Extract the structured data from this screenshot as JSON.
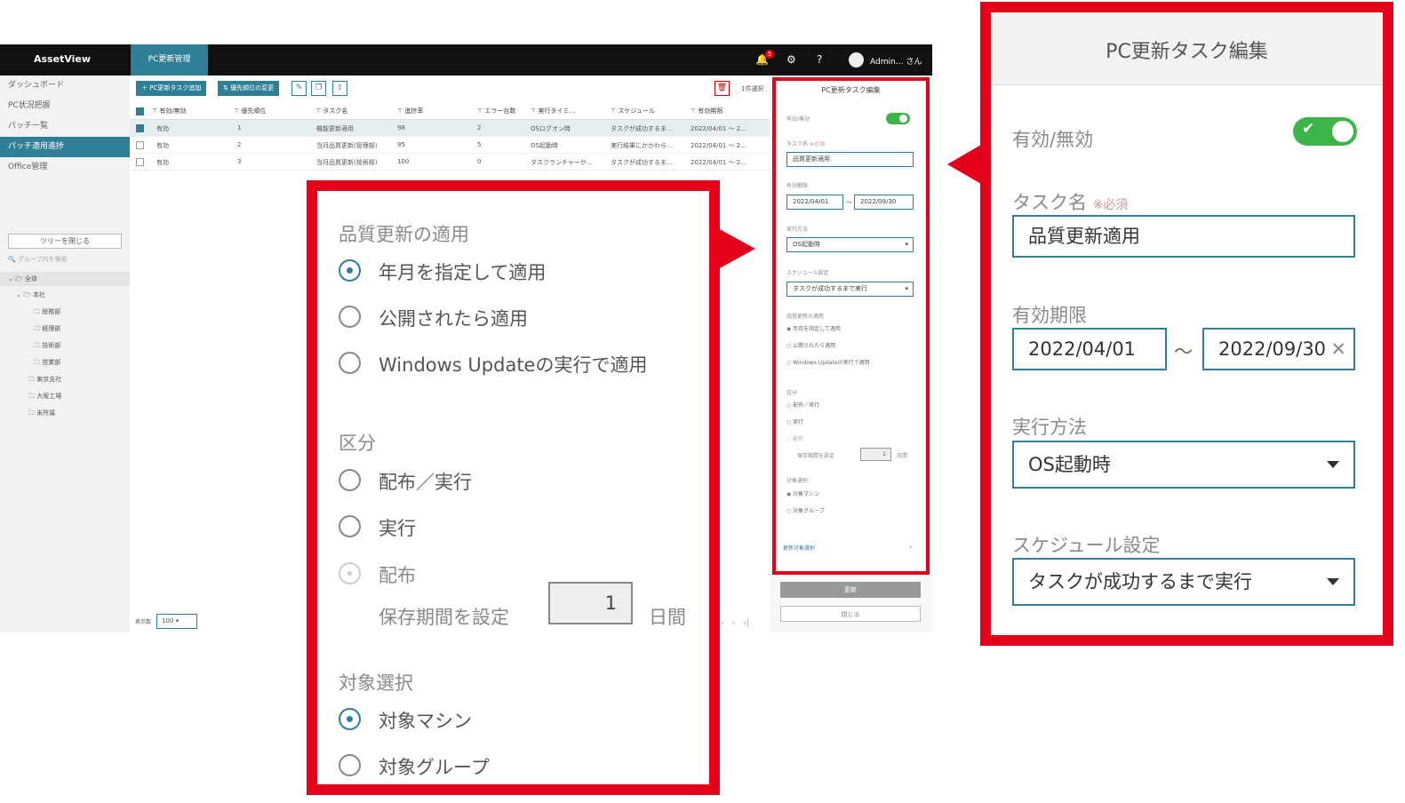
{
  "header": {
    "logo": "AssetView",
    "active_tab": "PC更新管理",
    "notification_count": "5",
    "user": "Admin… さん"
  },
  "sidebar": {
    "items": [
      {
        "label": "ダッシュボード"
      },
      {
        "label": "PC状況把握"
      },
      {
        "label": "パッチ一覧"
      },
      {
        "label": "パッチ適用進捗"
      },
      {
        "label": "Office管理"
      }
    ],
    "tree_button": "ツリーを閉じる",
    "group_search_placeholder": "グループ内を検索",
    "tree": {
      "root": "全体",
      "hq": "本社",
      "depts": [
        "総務部",
        "経理部",
        "技術部",
        "営業部"
      ],
      "branches": [
        "東京支社",
        "大阪工場",
        "未所属"
      ]
    }
  },
  "toolbar": {
    "add_task": "＋ PC更新タスク追加",
    "change_priority": "⇅ 優先順位の変更",
    "selected_count": "1件選択"
  },
  "table": {
    "headers": [
      "有効/無効",
      "優先順位",
      "タスク名",
      "進捗率",
      "エラー台数",
      "実行タイミ…",
      "スケジュール",
      "有効期限"
    ],
    "rows": [
      {
        "enabled": "有効",
        "priority": "1",
        "name": "機能更新適用",
        "progress": "98",
        "errors": "2",
        "timing": "OSログオン時",
        "schedule": "タスクが成功するま…",
        "expiry": "2022/04/01 ～ 2…"
      },
      {
        "enabled": "有効",
        "priority": "2",
        "name": "当月品質更新(管理部)",
        "progress": "95",
        "errors": "5",
        "timing": "OS起動時",
        "schedule": "実行結果にかかわら…",
        "expiry": "2022/04/01 ～ 2…"
      },
      {
        "enabled": "有効",
        "priority": "3",
        "name": "当月品質更新(技術部)",
        "progress": "100",
        "errors": "0",
        "timing": "タスクランチャーか…",
        "schedule": "タスクが成功するま…",
        "expiry": "2022/04/01 ～ 2…"
      }
    ],
    "page_size_label": "表示数",
    "page_size": "100"
  },
  "panel": {
    "title": "PC更新タスク編集",
    "enabled_label": "有効/無効",
    "task_name_label": "タスク名",
    "required_mark": "※必須",
    "task_name_value": "品質更新適用",
    "expiry_label": "有効期限",
    "expiry_from": "2022/04/01",
    "expiry_to": "2022/09/30",
    "tilde": "～",
    "method_label": "実行方法",
    "method_value": "OS起動時",
    "schedule_label": "スケジュール設定",
    "schedule_value": "タスクが成功するまで実行",
    "quality_label": "品質更新の適用",
    "quality_options": [
      "年月を指定して適用",
      "公開されたら適用",
      "Windows Updateの実行で適用"
    ],
    "category_label": "区分",
    "category_options": [
      "配布／実行",
      "実行",
      "配布"
    ],
    "retention_label": "保存期間を設定",
    "retention_value": "1",
    "retention_unit": "日間",
    "target_label": "対象選択",
    "target_options": [
      "対象マシン",
      "対象グループ"
    ],
    "update_target": "更新対象選択",
    "update_button": "更新",
    "close_button": "閉じる"
  },
  "colors": {
    "accent": "#2f7f97",
    "highlight": "#e3001b",
    "toggle_on": "#3cb44a"
  }
}
